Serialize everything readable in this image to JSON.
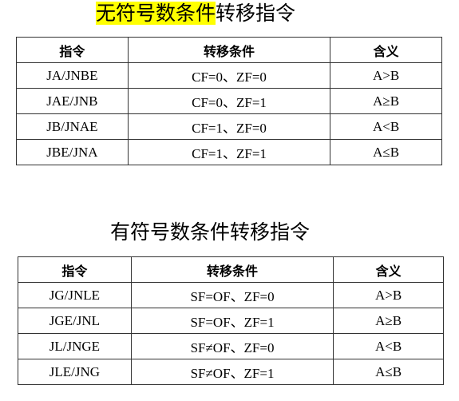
{
  "unsigned": {
    "title_highlighted": "无符号数条件",
    "title_rest": "转移指令",
    "highlight_color": "#ffff00",
    "headers": [
      "指令",
      "转移条件",
      "含义"
    ],
    "rows": [
      [
        "JA/JNBE",
        "CF=0、ZF=0",
        "A>B"
      ],
      [
        "JAE/JNB",
        "CF=0、ZF=1",
        "A≥B"
      ],
      [
        "JB/JNAE",
        "CF=1、ZF=0",
        "A<B"
      ],
      [
        "JBE/JNA",
        "CF=1、ZF=1",
        "A≤B"
      ]
    ]
  },
  "signed": {
    "title": "有符号数条件转移指令",
    "headers": [
      "指令",
      "转移条件",
      "含义"
    ],
    "rows": [
      [
        "JG/JNLE",
        "SF=OF、ZF=0",
        "A>B"
      ],
      [
        "JGE/JNL",
        "SF=OF、ZF=1",
        "A≥B"
      ],
      [
        "JL/JNGE",
        "SF≠OF、ZF=0",
        "A<B"
      ],
      [
        "JLE/JNG",
        "SF≠OF、ZF=1",
        "A≤B"
      ]
    ]
  }
}
